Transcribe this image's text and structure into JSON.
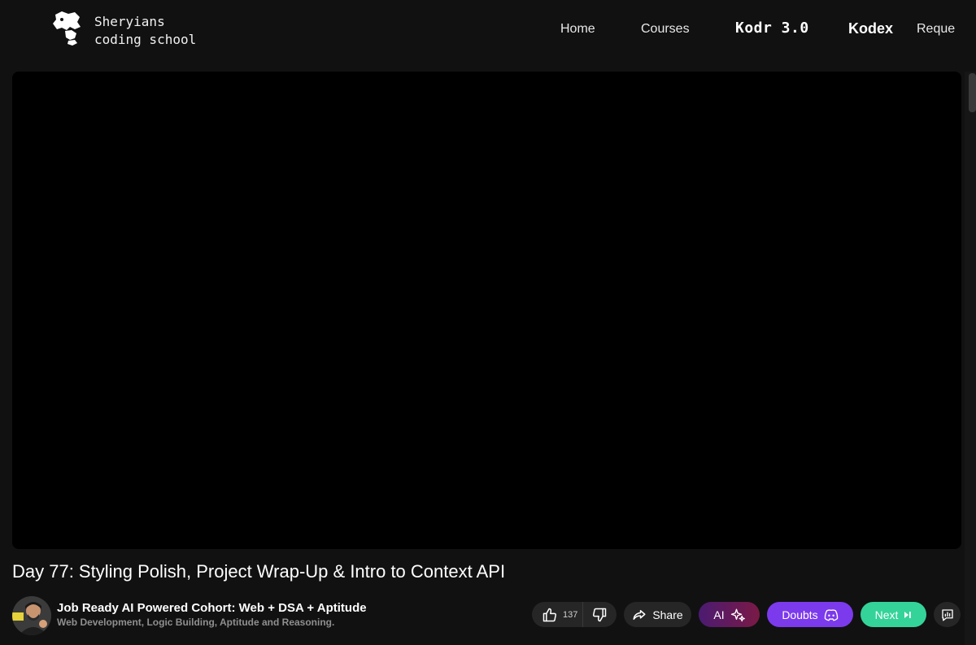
{
  "brand": {
    "line1": "Sheryians",
    "line2": "coding school"
  },
  "nav": {
    "items": [
      {
        "label": "Home"
      },
      {
        "label": "Courses"
      },
      {
        "label": "Kodr 3.0"
      },
      {
        "label": "Kodex"
      },
      {
        "label": "Reque"
      }
    ]
  },
  "lesson": {
    "title": "Day 77: Styling Polish, Project Wrap-Up & Intro to Context API"
  },
  "course": {
    "name": "Job Ready AI Powered Cohort: Web + DSA + Aptitude",
    "subtitle": "Web Development, Logic Building, Aptitude and Reasoning."
  },
  "actions": {
    "like_count": "137",
    "share_label": "Share",
    "ai_label": "AI",
    "doubts_label": "Doubts",
    "next_label": "Next"
  },
  "icons": {
    "logo": "lion-logo-icon",
    "like": "thumbs-up-icon",
    "dislike": "thumbs-down-icon",
    "share": "share-arrow-icon",
    "ai": "sparkles-icon",
    "doubts": "discord-icon",
    "next": "skip-next-icon",
    "stats": "chart-bars-icon"
  },
  "colors": {
    "background": "#111111",
    "video": "#000000",
    "doubts": "#7c3aed",
    "next": "#34d399",
    "ai_start": "#4b1b72",
    "ai_end": "#7a1a45"
  }
}
